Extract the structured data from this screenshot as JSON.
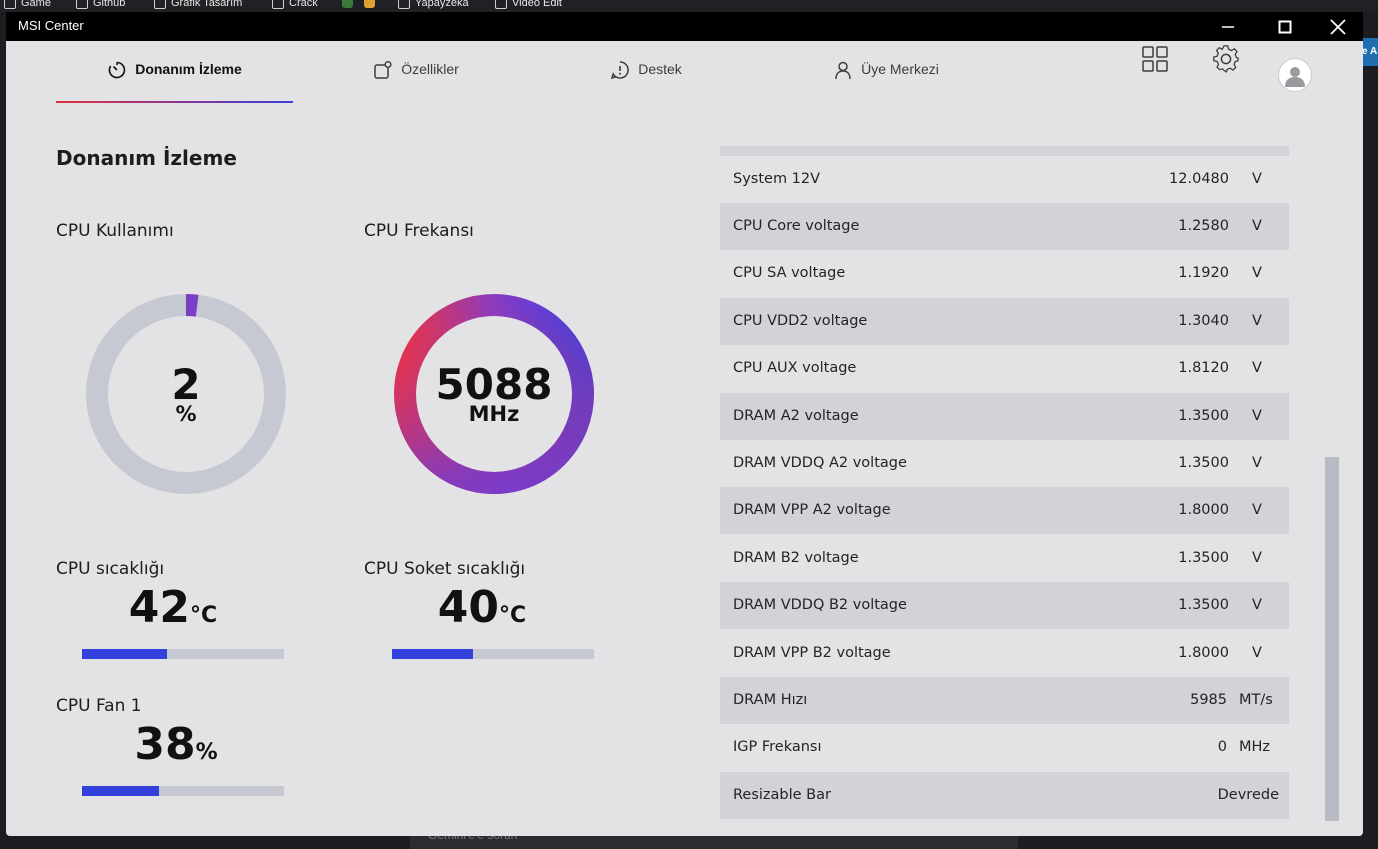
{
  "bookmarks": [
    {
      "label": "Game"
    },
    {
      "label": "Github"
    },
    {
      "label": "Grafik Tasarım"
    },
    {
      "label": "Crack"
    },
    {
      "label": ""
    },
    {
      "label": ""
    },
    {
      "label": "Yapayzeka"
    },
    {
      "label": "Video Edit"
    }
  ],
  "background": {
    "under_window_text": "Gemini'e'e sorun",
    "right_edge_text": "e Al"
  },
  "window": {
    "title": "MSI Center",
    "controls": [
      "minimize-icon",
      "maximize-icon",
      "close-icon"
    ]
  },
  "nav": {
    "tabs": [
      {
        "label": "Donanım İzleme",
        "icon": "gauge-icon",
        "active": true
      },
      {
        "label": "Özellikler",
        "icon": "features-icon",
        "active": false
      },
      {
        "label": "Destek",
        "icon": "alert-icon",
        "active": false
      },
      {
        "label": "Üye Merkezi",
        "icon": "user-icon",
        "active": false
      }
    ],
    "right_icons": [
      "grid-icon",
      "gear-icon",
      "avatar"
    ],
    "accent_gradient": [
      "#e03040",
      "#3b3fdd"
    ]
  },
  "page": {
    "title": "Donanım İzleme"
  },
  "metrics": {
    "cpu_usage": {
      "label": "CPU Kullanımı",
      "value": "2",
      "unit": "%",
      "fraction": 0.02,
      "color": "#7a3fc4"
    },
    "cpu_freq": {
      "label": "CPU Frekansı",
      "value": "5088",
      "unit": "MHz",
      "gradient": [
        "#e8334a",
        "#3a40e6"
      ]
    },
    "cpu_temp": {
      "label": "CPU sıcaklığı",
      "value": "42",
      "unit": "°C",
      "fraction": 0.42
    },
    "socket_temp": {
      "label": "CPU Soket sıcaklığı",
      "value": "40",
      "unit": "°C",
      "fraction": 0.4
    },
    "cpu_fan": {
      "label": "CPU Fan 1",
      "value": "38",
      "unit": "%",
      "fraction": 0.38
    },
    "bar_color": "#3240dc",
    "track_color": "#c6c9d2"
  },
  "readings": [
    {
      "name": "System 12V",
      "value": "12.0480",
      "unit": "V"
    },
    {
      "name": "CPU Core voltage",
      "value": "1.2580",
      "unit": "V"
    },
    {
      "name": "CPU SA voltage",
      "value": "1.1920",
      "unit": "V"
    },
    {
      "name": "CPU VDD2 voltage",
      "value": "1.3040",
      "unit": "V"
    },
    {
      "name": "CPU AUX voltage",
      "value": "1.8120",
      "unit": "V"
    },
    {
      "name": "DRAM A2 voltage",
      "value": "1.3500",
      "unit": "V"
    },
    {
      "name": "DRAM VDDQ A2 voltage",
      "value": "1.3500",
      "unit": "V"
    },
    {
      "name": "DRAM VPP A2 voltage",
      "value": "1.8000",
      "unit": "V"
    },
    {
      "name": "DRAM B2 voltage",
      "value": "1.3500",
      "unit": "V"
    },
    {
      "name": "DRAM VDDQ B2 voltage",
      "value": "1.3500",
      "unit": "V"
    },
    {
      "name": "DRAM VPP B2 voltage",
      "value": "1.8000",
      "unit": "V"
    },
    {
      "name": "DRAM Hızı",
      "value": "5985",
      "unit": "MT/s"
    },
    {
      "name": "IGP Frekansı",
      "value": "0",
      "unit": "MHz"
    },
    {
      "name": "Resizable Bar",
      "value": "Devrede",
      "unit": ""
    }
  ]
}
